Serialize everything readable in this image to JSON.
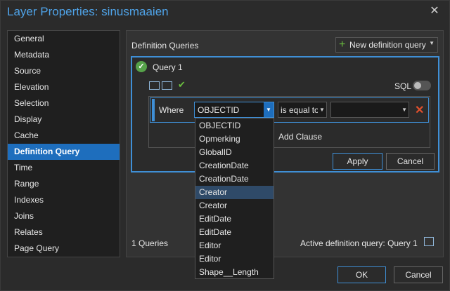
{
  "window": {
    "title": "Layer Properties: sinusmaaien",
    "close_glyph": "✕"
  },
  "sidebar": {
    "items": [
      {
        "label": "General"
      },
      {
        "label": "Metadata"
      },
      {
        "label": "Source"
      },
      {
        "label": "Elevation"
      },
      {
        "label": "Selection"
      },
      {
        "label": "Display"
      },
      {
        "label": "Cache"
      },
      {
        "label": "Definition Query",
        "selected": true
      },
      {
        "label": "Time"
      },
      {
        "label": "Range"
      },
      {
        "label": "Indexes"
      },
      {
        "label": "Joins"
      },
      {
        "label": "Relates"
      },
      {
        "label": "Page Query"
      }
    ]
  },
  "main": {
    "section_label": "Definition Queries",
    "new_query_button": "New definition query",
    "query": {
      "name": "Query 1",
      "sql_label": "SQL",
      "sql_enabled": false,
      "where_label": "Where",
      "field_value": "OBJECTID",
      "operator_value": "is equal to",
      "value_value": "",
      "add_clause_label": "Add Clause",
      "apply_label": "Apply",
      "cancel_label": "Cancel"
    },
    "field_options": [
      "OBJECTID",
      "Opmerking",
      "GlobalID",
      "CreationDate",
      "CreationDate",
      "Creator",
      "Creator",
      "EditDate",
      "EditDate",
      "Editor",
      "Editor",
      "Shape__Length"
    ],
    "highlighted_option_index": 5,
    "queries_count": "1 Queries",
    "active_query": "Active definition query: Query 1"
  },
  "footer": {
    "ok_label": "OK",
    "cancel_label": "Cancel"
  },
  "colors": {
    "accent": "#3f8fd6",
    "selected": "#1e6ebd",
    "success": "#56a24a",
    "danger": "#e0502d"
  }
}
